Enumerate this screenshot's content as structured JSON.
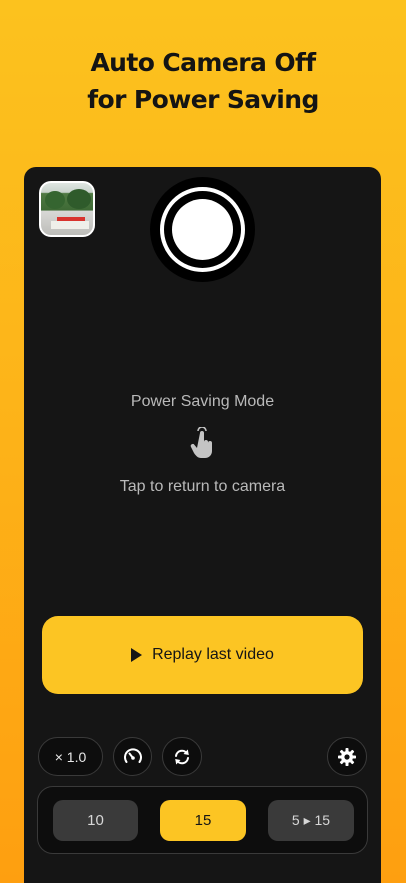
{
  "headline": {
    "line1": "Auto Camera Off",
    "line2": "for Power Saving"
  },
  "camera": {
    "thumbnail": "last-video-thumbnail",
    "shutter_icon": "record-button"
  },
  "power_saving": {
    "title": "Power Saving Mode",
    "icon": "tap-hand-icon",
    "subtitle": "Tap to return to camera"
  },
  "replay": {
    "label": "Replay last video",
    "icon": "play-icon"
  },
  "controls": {
    "zoom_label": "× 1.0",
    "speed_icon": "speedometer-icon",
    "flip_icon": "camera-flip-icon",
    "settings_icon": "gear-icon"
  },
  "duration": {
    "options": [
      "10",
      "15",
      "5 ▸ 15"
    ],
    "selected": "15"
  },
  "colors": {
    "accent": "#FCC523",
    "background_top": "#FCC21E",
    "background_bottom": "#FE9F10",
    "panel": "#151515"
  }
}
